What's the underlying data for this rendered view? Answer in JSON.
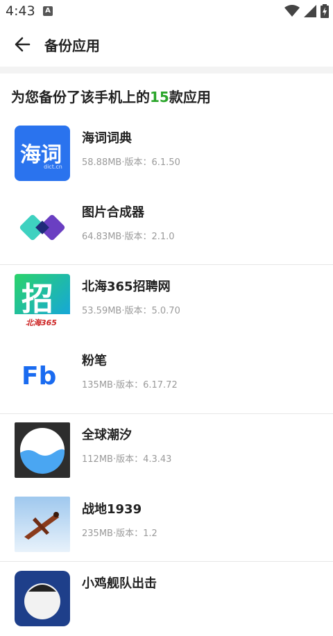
{
  "status_bar": {
    "time": "4:43",
    "notification_letter": "A"
  },
  "header": {
    "title": "备份应用"
  },
  "summary": {
    "prefix": "为您备份了该手机上的",
    "count": "15",
    "suffix": "款应用"
  },
  "apps": [
    {
      "name": "海词词典",
      "size": "58.88MB",
      "version_label": "·版本：",
      "version": "6.1.50",
      "icon": "dict-icon",
      "icon_text": "海词",
      "icon_subtext": "dict.cn"
    },
    {
      "name": "图片合成器",
      "size": "64.83MB",
      "version_label": "·版本：",
      "version": "2.1.0",
      "icon": "image-combiner-icon"
    },
    {
      "name": "北海365招聘网",
      "size": "53.59MB",
      "version_label": "·版本：",
      "version": "5.0.70",
      "icon": "recruit-icon",
      "icon_text": "招",
      "icon_subtext": "北海365"
    },
    {
      "name": "粉笔",
      "size": "135MB",
      "version_label": "·版本：",
      "version": "6.17.72",
      "icon": "fenbi-icon",
      "icon_text": "Fb"
    },
    {
      "name": "全球潮汐",
      "size": "112MB",
      "version_label": "·版本：",
      "version": "4.3.43",
      "icon": "tide-icon"
    },
    {
      "name": "战地1939",
      "size": "235MB",
      "version_label": "·版本：",
      "version": "1.2",
      "icon": "warplane-icon"
    },
    {
      "name": "小鸡舰队出击",
      "icon": "chicken-fleet-icon"
    }
  ],
  "colors": {
    "accent_green": "#2aa52a",
    "dict_blue": "#2a73ee",
    "fenbi_blue": "#1a6bf0"
  }
}
